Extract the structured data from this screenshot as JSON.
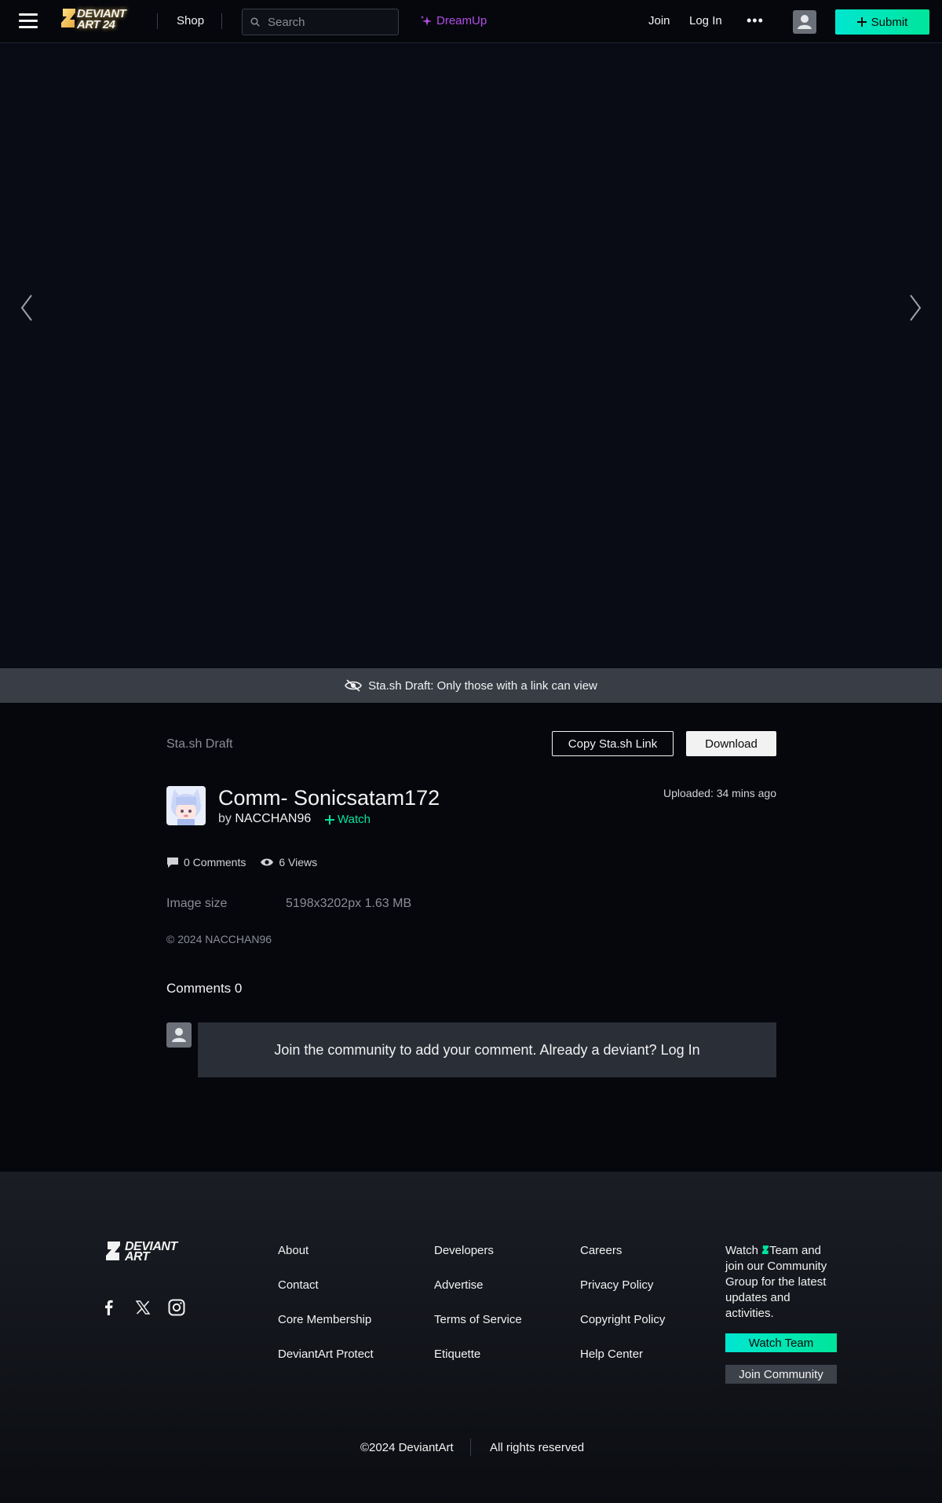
{
  "header": {
    "logo_text_line1": "DEVIANT",
    "logo_text_line2": "ART 24",
    "shop": "Shop",
    "search_placeholder": "Search",
    "dreamup": "DreamUp",
    "join": "Join",
    "login": "Log In",
    "more": "•••",
    "submit": "Submit"
  },
  "banner": {
    "text": "Sta.sh Draft: Only those with a link can view"
  },
  "deviation": {
    "draft_label": "Sta.sh Draft",
    "copy_link": "Copy Sta.sh Link",
    "download": "Download",
    "title": "Comm- Sonicsatam172",
    "by": "by",
    "author": "NACCHAN96",
    "watch": "Watch",
    "uploaded_label": "Uploaded:",
    "uploaded_time": "34 mins ago",
    "comments_stat": "0 Comments",
    "views_stat": "6 Views",
    "image_size_label": "Image size",
    "image_size_value": "5198x3202px 1.63 MB",
    "copyright": "© 2024 NACCHAN96"
  },
  "comments": {
    "title": "Comments",
    "count": "0",
    "prompt": "Join the community to add your comment. Already a deviant? Log In"
  },
  "footer": {
    "logo_line1": "DEVIANT",
    "logo_line2": "ART",
    "col1": [
      "About",
      "Contact",
      "Core Membership",
      "DeviantArt Protect"
    ],
    "col2": [
      "Developers",
      "Advertise",
      "Terms of Service",
      "Etiquette"
    ],
    "col3": [
      "Careers",
      "Privacy Policy",
      "Copyright Policy",
      "Help Center"
    ],
    "watch_pre": "Watch",
    "watch_post": "Team and join our Community Group for the latest updates and activities.",
    "watch_team": "Watch Team",
    "join_community": "Join Community",
    "copyright": "©2024 DeviantArt",
    "rights": "All rights reserved"
  },
  "colors": {
    "accent_green": "#00e59b",
    "dreamup_purple": "#b14fe5",
    "background": "#06070d"
  }
}
